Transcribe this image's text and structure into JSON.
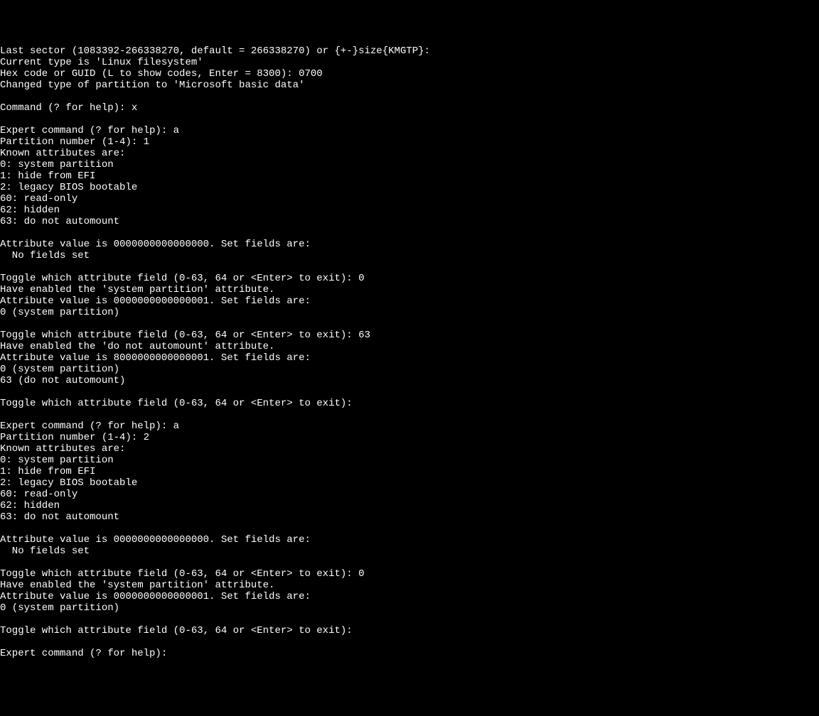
{
  "lines": [
    "Last sector (1083392-266338270, default = 266338270) or {+-}size{KMGTP}:",
    "Current type is 'Linux filesystem'",
    "Hex code or GUID (L to show codes, Enter = 8300): 0700",
    "Changed type of partition to 'Microsoft basic data'",
    "",
    "Command (? for help): x",
    "",
    "Expert command (? for help): a",
    "Partition number (1-4): 1",
    "Known attributes are:",
    "0: system partition",
    "1: hide from EFI",
    "2: legacy BIOS bootable",
    "60: read-only",
    "62: hidden",
    "63: do not automount",
    "",
    "Attribute value is 0000000000000000. Set fields are:",
    "  No fields set",
    "",
    "Toggle which attribute field (0-63, 64 or <Enter> to exit): 0",
    "Have enabled the 'system partition' attribute.",
    "Attribute value is 0000000000000001. Set fields are:",
    "0 (system partition)",
    "",
    "Toggle which attribute field (0-63, 64 or <Enter> to exit): 63",
    "Have enabled the 'do not automount' attribute.",
    "Attribute value is 8000000000000001. Set fields are:",
    "0 (system partition)",
    "63 (do not automount)",
    "",
    "Toggle which attribute field (0-63, 64 or <Enter> to exit):",
    "",
    "Expert command (? for help): a",
    "Partition number (1-4): 2",
    "Known attributes are:",
    "0: system partition",
    "1: hide from EFI",
    "2: legacy BIOS bootable",
    "60: read-only",
    "62: hidden",
    "63: do not automount",
    "",
    "Attribute value is 0000000000000000. Set fields are:",
    "  No fields set",
    "",
    "Toggle which attribute field (0-63, 64 or <Enter> to exit): 0",
    "Have enabled the 'system partition' attribute.",
    "Attribute value is 0000000000000001. Set fields are:",
    "0 (system partition)",
    "",
    "Toggle which attribute field (0-63, 64 or <Enter> to exit):",
    "",
    "Expert command (? for help):"
  ]
}
